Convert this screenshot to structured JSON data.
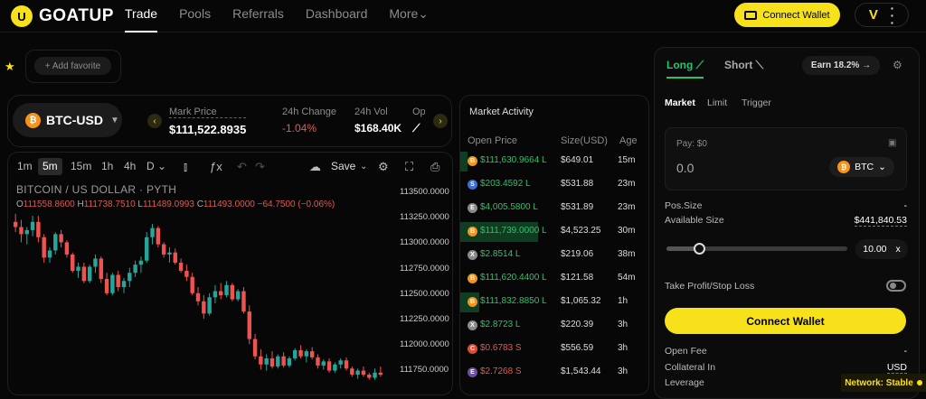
{
  "brand": {
    "name": "GOATUP"
  },
  "nav": [
    {
      "label": "Trade"
    },
    {
      "label": "Pools"
    },
    {
      "label": "Referrals"
    },
    {
      "label": "Dashboard"
    },
    {
      "label": "More"
    }
  ],
  "header": {
    "connect_label": "Connect Wallet"
  },
  "favorites": {
    "add_label": "+ Add favorite"
  },
  "ticker": {
    "pair": "BTC-USD",
    "stats": [
      {
        "label": "Mark Price",
        "value": "$111,522.8935"
      },
      {
        "label": "24h Change",
        "value": "-1.04%"
      },
      {
        "label": "24h Vol",
        "value": "$168.40K"
      },
      {
        "label": "Op",
        "value": ""
      }
    ]
  },
  "chart": {
    "timeframes": [
      "1m",
      "5m",
      "15m",
      "1h",
      "4h",
      "D"
    ],
    "active_timeframe": "5m",
    "save_label": "Save",
    "title": "BITCOIN / US DOLLAR · PYTH",
    "ohlc": {
      "o": "111558.8600",
      "h": "111738.7510",
      "l": "111489.0993",
      "c": "111493.0000",
      "chg": "−64.7500 (−0.06%)"
    }
  },
  "chart_data": {
    "type": "candlestick",
    "y_ticks": [
      "113500.0000",
      "113250.0000",
      "113000.0000",
      "112750.0000",
      "112500.0000",
      "112250.0000",
      "112000.0000",
      "111750.0000"
    ],
    "ylim": [
      111650,
      113600
    ],
    "candles": [
      {
        "o": 113200,
        "h": 113280,
        "l": 113100,
        "c": 113150
      },
      {
        "o": 113150,
        "h": 113220,
        "l": 113000,
        "c": 113080
      },
      {
        "o": 113080,
        "h": 113150,
        "l": 112980,
        "c": 113120
      },
      {
        "o": 113120,
        "h": 113260,
        "l": 113060,
        "c": 113200
      },
      {
        "o": 113200,
        "h": 113260,
        "l": 113000,
        "c": 113050
      },
      {
        "o": 113050,
        "h": 113080,
        "l": 112800,
        "c": 112850
      },
      {
        "o": 112850,
        "h": 112950,
        "l": 112800,
        "c": 112920
      },
      {
        "o": 112920,
        "h": 113100,
        "l": 112880,
        "c": 113080
      },
      {
        "o": 113080,
        "h": 113120,
        "l": 112950,
        "c": 113000
      },
      {
        "o": 113000,
        "h": 113020,
        "l": 112850,
        "c": 112880
      },
      {
        "o": 112880,
        "h": 112900,
        "l": 112700,
        "c": 112720
      },
      {
        "o": 112720,
        "h": 112800,
        "l": 112650,
        "c": 112760
      },
      {
        "o": 112760,
        "h": 112800,
        "l": 112600,
        "c": 112620
      },
      {
        "o": 112620,
        "h": 112780,
        "l": 112600,
        "c": 112760
      },
      {
        "o": 112760,
        "h": 112880,
        "l": 112700,
        "c": 112840
      },
      {
        "o": 112840,
        "h": 112860,
        "l": 112600,
        "c": 112640
      },
      {
        "o": 112640,
        "h": 112700,
        "l": 112480,
        "c": 112500
      },
      {
        "o": 112500,
        "h": 112700,
        "l": 112480,
        "c": 112680
      },
      {
        "o": 112680,
        "h": 112720,
        "l": 112520,
        "c": 112560
      },
      {
        "o": 112560,
        "h": 112650,
        "l": 112500,
        "c": 112620
      },
      {
        "o": 112620,
        "h": 112750,
        "l": 112560,
        "c": 112700
      },
      {
        "o": 112700,
        "h": 112820,
        "l": 112660,
        "c": 112780
      },
      {
        "o": 112780,
        "h": 112860,
        "l": 112700,
        "c": 112820
      },
      {
        "o": 112820,
        "h": 113100,
        "l": 112800,
        "c": 113050
      },
      {
        "o": 113050,
        "h": 113180,
        "l": 112980,
        "c": 113140
      },
      {
        "o": 113140,
        "h": 113160,
        "l": 112950,
        "c": 112980
      },
      {
        "o": 112980,
        "h": 113000,
        "l": 112850,
        "c": 112880
      },
      {
        "o": 112880,
        "h": 112950,
        "l": 112800,
        "c": 112900
      },
      {
        "o": 112900,
        "h": 112940,
        "l": 112780,
        "c": 112800
      },
      {
        "o": 112800,
        "h": 112840,
        "l": 112700,
        "c": 112720
      },
      {
        "o": 112720,
        "h": 112780,
        "l": 112620,
        "c": 112660
      },
      {
        "o": 112660,
        "h": 112700,
        "l": 112480,
        "c": 112500
      },
      {
        "o": 112500,
        "h": 112560,
        "l": 112380,
        "c": 112420
      },
      {
        "o": 112420,
        "h": 112480,
        "l": 112250,
        "c": 112300
      },
      {
        "o": 112300,
        "h": 112500,
        "l": 112280,
        "c": 112460
      },
      {
        "o": 112460,
        "h": 112580,
        "l": 112400,
        "c": 112520
      },
      {
        "o": 112520,
        "h": 112600,
        "l": 112440,
        "c": 112480
      },
      {
        "o": 112480,
        "h": 112620,
        "l": 112460,
        "c": 112580
      },
      {
        "o": 112580,
        "h": 112600,
        "l": 112420,
        "c": 112440
      },
      {
        "o": 112440,
        "h": 112540,
        "l": 112420,
        "c": 112520
      },
      {
        "o": 112520,
        "h": 112560,
        "l": 112300,
        "c": 112320
      },
      {
        "o": 112320,
        "h": 112380,
        "l": 112000,
        "c": 112050
      },
      {
        "o": 112050,
        "h": 112100,
        "l": 111850,
        "c": 111880
      },
      {
        "o": 111880,
        "h": 111950,
        "l": 111750,
        "c": 111800
      },
      {
        "o": 111800,
        "h": 111900,
        "l": 111740,
        "c": 111860
      },
      {
        "o": 111860,
        "h": 111930,
        "l": 111760,
        "c": 111780
      },
      {
        "o": 111780,
        "h": 111900,
        "l": 111760,
        "c": 111880
      },
      {
        "o": 111880,
        "h": 111920,
        "l": 111770,
        "c": 111790
      },
      {
        "o": 111790,
        "h": 111880,
        "l": 111770,
        "c": 111860
      },
      {
        "o": 111860,
        "h": 111960,
        "l": 111840,
        "c": 111940
      },
      {
        "o": 111940,
        "h": 111990,
        "l": 111860,
        "c": 111880
      },
      {
        "o": 111880,
        "h": 111950,
        "l": 111820,
        "c": 111930
      },
      {
        "o": 111930,
        "h": 111970,
        "l": 111850,
        "c": 111870
      },
      {
        "o": 111870,
        "h": 111900,
        "l": 111760,
        "c": 111790
      },
      {
        "o": 111790,
        "h": 111850,
        "l": 111750,
        "c": 111830
      },
      {
        "o": 111830,
        "h": 111860,
        "l": 111720,
        "c": 111740
      },
      {
        "o": 111740,
        "h": 111820,
        "l": 111720,
        "c": 111800
      },
      {
        "o": 111800,
        "h": 111860,
        "l": 111760,
        "c": 111840
      },
      {
        "o": 111840,
        "h": 111870,
        "l": 111740,
        "c": 111760
      },
      {
        "o": 111760,
        "h": 111780,
        "l": 111680,
        "c": 111700
      },
      {
        "o": 111700,
        "h": 111760,
        "l": 111660,
        "c": 111740
      },
      {
        "o": 111740,
        "h": 111780,
        "l": 111680,
        "c": 111700
      },
      {
        "o": 111700,
        "h": 111720,
        "l": 111650,
        "c": 111670
      },
      {
        "o": 111670,
        "h": 111760,
        "l": 111650,
        "c": 111720
      },
      {
        "o": 111720,
        "h": 111780,
        "l": 111680,
        "c": 111700
      }
    ]
  },
  "market_activity": {
    "title": "Market Activity",
    "headers": [
      "Open Price",
      "Size(USD)",
      "Age"
    ],
    "rows": [
      {
        "coin": "BTC",
        "coin_color": "#f7931a",
        "price": "$111,630.9664 L",
        "side": "L",
        "size": "$649.01",
        "age": "15m",
        "bar": 0.04
      },
      {
        "coin": "SOL",
        "coin_color": "#3b6ed8",
        "price": "$203.4592 L",
        "side": "L",
        "size": "$531.88",
        "age": "23m",
        "bar": 0
      },
      {
        "coin": "ETH",
        "coin_color": "#8a8a8a",
        "price": "$4,005.5800 L",
        "side": "L",
        "size": "$531.89",
        "age": "23m",
        "bar": 0
      },
      {
        "coin": "BTC",
        "coin_color": "#f7931a",
        "price": "$111,739.0000 L",
        "side": "L",
        "size": "$4,523.25",
        "age": "30m",
        "bar": 0.41
      },
      {
        "coin": "XRP",
        "coin_color": "#8a8a8a",
        "price": "$2.8514 L",
        "side": "L",
        "size": "$219.06",
        "age": "38m",
        "bar": 0
      },
      {
        "coin": "BTC",
        "coin_color": "#f7931a",
        "price": "$111,620.4400 L",
        "side": "L",
        "size": "$121.58",
        "age": "54m",
        "bar": 0
      },
      {
        "coin": "BTC",
        "coin_color": "#f7931a",
        "price": "$111,832.8850 L",
        "side": "L",
        "size": "$1,065.32",
        "age": "1h",
        "bar": 0.1
      },
      {
        "coin": "XRP",
        "coin_color": "#8a8a8a",
        "price": "$2.8723 L",
        "side": "L",
        "size": "$220.39",
        "age": "3h",
        "bar": 0
      },
      {
        "coin": "CHR",
        "coin_color": "#e34b2c",
        "price": "$0.6783 S",
        "side": "S",
        "size": "$556.59",
        "age": "3h",
        "bar": 0
      },
      {
        "coin": "ETC",
        "coin_color": "#6b4fa3",
        "price": "$2.7268 S",
        "side": "S",
        "size": "$1,543.44",
        "age": "3h",
        "bar": 0
      }
    ]
  },
  "trade": {
    "long_label": "Long",
    "short_label": "Short",
    "earn_label": "Earn 18.2% →",
    "order_types": [
      "Market",
      "Limit",
      "Trigger"
    ],
    "pay_label": "Pay: $0",
    "pay_value": "0.0",
    "pay_coin": "BTC",
    "pos_size_label": "Pos.Size",
    "pos_size_value": "-",
    "available_label": "Available Size",
    "available_value": "$441,840.53",
    "leverage_value": "10.00",
    "leverage_unit": "x",
    "leverage_fraction": 0.18,
    "tpsl_label": "Take Profit/Stop Loss",
    "connect_label": "Connect Wallet",
    "open_fee_label": "Open Fee",
    "open_fee_value": "-",
    "collateral_label": "Collateral In",
    "collateral_value": "USD",
    "leverage_label": "Leverage"
  },
  "status": {
    "network": "Network: Stable"
  }
}
